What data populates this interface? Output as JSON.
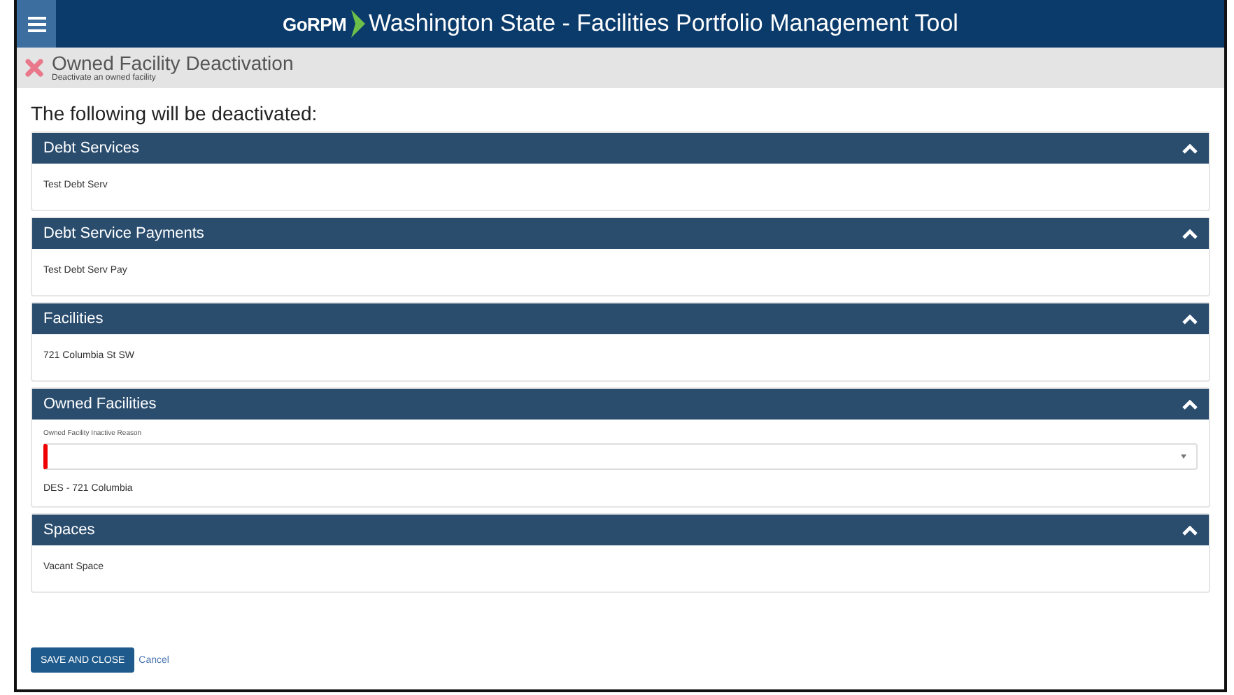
{
  "app_bar": {
    "brand": "GoRPM",
    "title": "Washington State - Facilities Portfolio Management Tool"
  },
  "page_header": {
    "title": "Owned Facility Deactivation",
    "subtitle": "Deactivate an owned facility"
  },
  "intro": "The following will be deactivated:",
  "sections": [
    {
      "title": "Debt Services",
      "expanded": true,
      "items": [
        "Test Debt Serv"
      ]
    },
    {
      "title": "Debt Service Payments",
      "expanded": true,
      "items": [
        "Test Debt Serv Pay"
      ]
    },
    {
      "title": "Facilities",
      "expanded": true,
      "items": [
        "721 Columbia St SW"
      ]
    },
    {
      "title": "Owned Facilities",
      "expanded": true,
      "field": {
        "label": "Owned Facility Inactive Reason",
        "required": true
      },
      "items": [
        "DES - 721 Columbia"
      ]
    },
    {
      "title": "Spaces",
      "expanded": true,
      "items": [
        "Vacant Space"
      ]
    }
  ],
  "actions": {
    "save": "SAVE AND CLOSE",
    "cancel": "Cancel"
  }
}
